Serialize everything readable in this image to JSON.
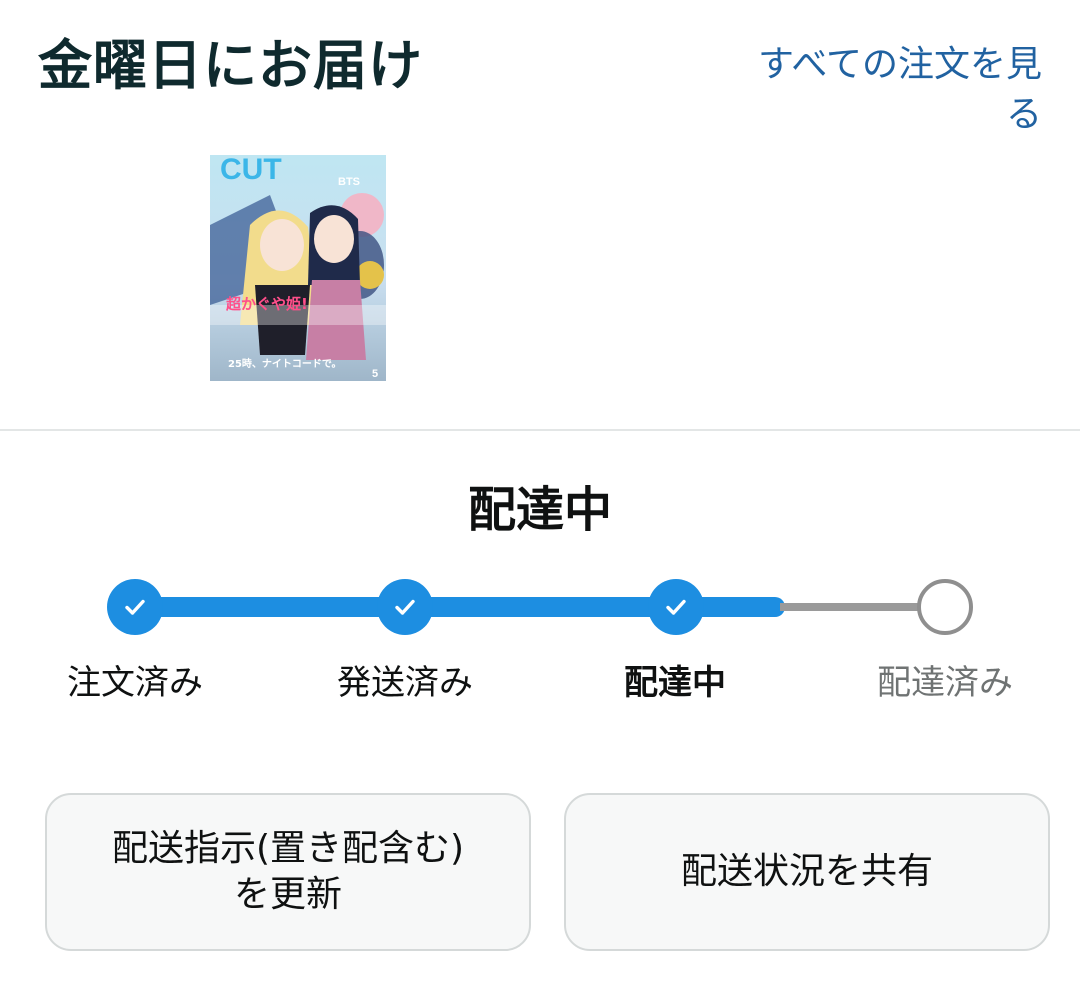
{
  "header": {
    "title": "金曜日にお届け",
    "view_all_link": "すべての注文を見る"
  },
  "product": {
    "image_icon": "magazine-cover-image",
    "cover_text": {
      "masthead": "CUT",
      "artist": "BTS",
      "headline": "超かぐや姫!",
      "tagline": "25時、ナイトコードで。",
      "issue": "5"
    }
  },
  "status": {
    "title": "配達中"
  },
  "steps": [
    {
      "label": "注文済み",
      "state": "done",
      "icon": "check-icon"
    },
    {
      "label": "発送済み",
      "state": "done",
      "icon": "check-icon"
    },
    {
      "label": "配達中",
      "state": "current",
      "icon": "check-icon"
    },
    {
      "label": "配達済み",
      "state": "pending",
      "icon": "empty-circle-icon"
    }
  ],
  "actions": {
    "update_delivery_line1": "配送指示(置き配含む)",
    "update_delivery_line2": "を更新",
    "share_tracking": "配送状況を共有"
  },
  "colors": {
    "accent": "#1d8ee1",
    "link": "#2162a1",
    "title": "#0f2a2e",
    "pending": "#9a9a9a",
    "button_bg": "#f7f8f8",
    "button_border": "#d5d9d9"
  }
}
